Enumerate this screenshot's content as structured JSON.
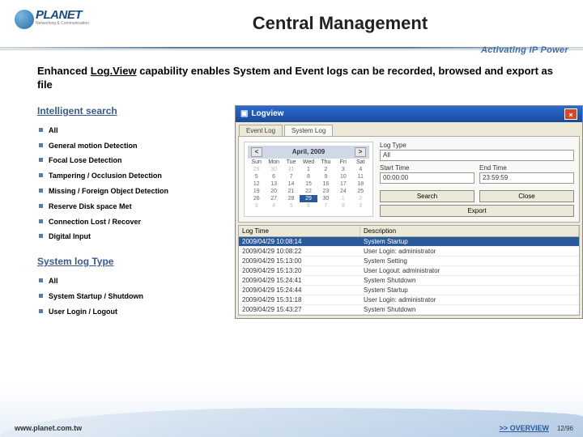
{
  "logo": {
    "brand": "PLANET",
    "sub": "Networking & Communication"
  },
  "title": "Central Management",
  "tagline": "Activating IP Power",
  "intro": {
    "pre": "Enhanced",
    "u": "Log.View",
    "post": "capability enables System and Event logs can be recorded, browsed and export as file"
  },
  "subheads": {
    "search": "Intelligent search",
    "systype": "System log Type"
  },
  "search_items": [
    "All",
    "General motion Detection",
    "Focal Lose Detection",
    "Tampering / Occlusion Detection",
    "Missing / Foreign Object Detection",
    "Reserve Disk space Met",
    "Connection Lost / Recover",
    "Digital Input"
  ],
  "type_items": [
    "All",
    "System Startup / Shutdown",
    "User Login / Logout"
  ],
  "logview": {
    "title": "Logview",
    "tabs": [
      "Event Log",
      "System Log"
    ],
    "cal": {
      "month": "April, 2009",
      "selected": "29",
      "dh": [
        "Sun",
        "Mon",
        "Tue",
        "Wed",
        "Thu",
        "Fri",
        "Sat"
      ]
    },
    "labels": {
      "logtype": "Log Type",
      "start": "Start Time",
      "end": "End Time"
    },
    "values": {
      "logtype": "All",
      "start": "00:00:00",
      "end": "23:59:59"
    },
    "buttons": {
      "search": "Search",
      "close": "Close",
      "export": "Export"
    },
    "cols": [
      "Log Time",
      "Description"
    ],
    "rows": [
      {
        "t": "2009/04/29  10:08:14",
        "d": "System Startup"
      },
      {
        "t": "2009/04/29  10:08:22",
        "d": "User Login: administrator"
      },
      {
        "t": "2009/04/29  15:13:00",
        "d": "System Setting"
      },
      {
        "t": "2009/04/29  15:13:20",
        "d": "User Logout: administrator"
      },
      {
        "t": "2009/04/29  15:24:41",
        "d": "System Shutdown"
      },
      {
        "t": "2009/04/29  15:24:44",
        "d": "System Startup"
      },
      {
        "t": "2009/04/29  15:31:18",
        "d": "User Login: administrator"
      },
      {
        "t": "2009/04/29  15:43:27",
        "d": "System Shutdown"
      }
    ]
  },
  "footer": {
    "url": "www.planet.com.tw",
    "overview": ">> OVERVIEW",
    "page": "12/96"
  }
}
